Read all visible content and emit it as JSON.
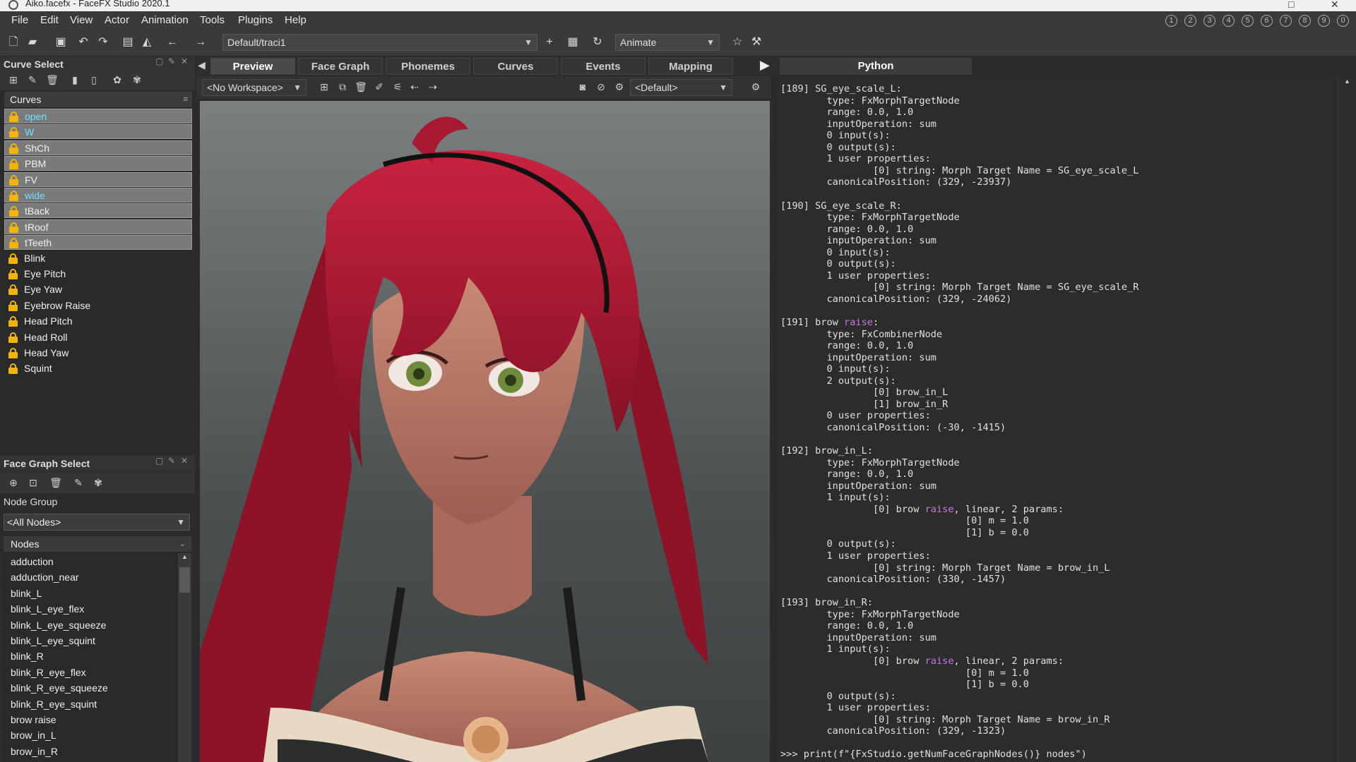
{
  "window": {
    "title": "Aiko.facefx - FaceFX Studio 2020.1"
  },
  "menu": [
    "File",
    "Edit",
    "View",
    "Actor",
    "Animation",
    "Tools",
    "Plugins",
    "Help"
  ],
  "workspace_slots": [
    "1",
    "2",
    "3",
    "4",
    "5",
    "6",
    "7",
    "8",
    "9",
    "0"
  ],
  "toolbar": {
    "path_combo": "Default/traci1",
    "mode_combo": "Animate"
  },
  "curve_select": {
    "title": "Curve Select",
    "list_header": "Curves",
    "items": [
      {
        "label": "open",
        "selected": true,
        "color": "#6fe0ff"
      },
      {
        "label": "W",
        "selected": true,
        "color": "#6fe0ff"
      },
      {
        "label": "ShCh",
        "selected": true
      },
      {
        "label": "PBM",
        "selected": true
      },
      {
        "label": "FV",
        "selected": true
      },
      {
        "label": "wide",
        "selected": true,
        "color": "#6fe0ff"
      },
      {
        "label": "tBack",
        "selected": true
      },
      {
        "label": "tRoof",
        "selected": true
      },
      {
        "label": "tTeeth",
        "selected": true
      },
      {
        "label": "Blink"
      },
      {
        "label": "Eye Pitch"
      },
      {
        "label": "Eye Yaw"
      },
      {
        "label": "Eyebrow Raise"
      },
      {
        "label": "Head Pitch"
      },
      {
        "label": "Head Roll"
      },
      {
        "label": "Head Yaw"
      },
      {
        "label": "Squint"
      }
    ]
  },
  "face_graph_select": {
    "title": "Face Graph Select",
    "node_group_label": "Node Group",
    "node_group_value": "<All Nodes>",
    "nodes_header": "Nodes",
    "nodes": [
      "adduction",
      "adduction_near",
      "blink_L",
      "blink_L_eye_flex",
      "blink_L_eye_squeeze",
      "blink_L_eye_squint",
      "blink_R",
      "blink_R_eye_flex",
      "blink_R_eye_squeeze",
      "blink_R_eye_squint",
      "brow raise",
      "brow_in_L",
      "brow_in_R"
    ]
  },
  "center_tabs": [
    "Preview",
    "Face Graph",
    "Phonemes",
    "Curves",
    "Events",
    "Mapping"
  ],
  "viewport_bar": {
    "workspace": "<No Workspace>",
    "camera": "<Default>"
  },
  "python": {
    "tab": "Python",
    "lines": [
      "[189] SG_eye_scale_L:",
      "        type: FxMorphTargetNode",
      "        range: 0.0, 1.0",
      "        inputOperation: sum",
      "        0 input(s):",
      "        0 output(s):",
      "        1 user properties:",
      "                [0] string: Morph Target Name = SG_eye_scale_L",
      "        canonicalPosition: (329, -23937)",
      "",
      "[190] SG_eye_scale_R:",
      "        type: FxMorphTargetNode",
      "        range: 0.0, 1.0",
      "        inputOperation: sum",
      "        0 input(s):",
      "        0 output(s):",
      "        1 user properties:",
      "                [0] string: Morph Target Name = SG_eye_scale_R",
      "        canonicalPosition: (329, -24062)",
      "",
      "[191] brow raise:",
      "        type: FxCombinerNode",
      "        range: 0.0, 1.0",
      "        inputOperation: sum",
      "        0 input(s):",
      "        2 output(s):",
      "                [0] brow_in_L",
      "                [1] brow_in_R",
      "        0 user properties:",
      "        canonicalPosition: (-30, -1415)",
      "",
      "[192] brow_in_L:",
      "        type: FxMorphTargetNode",
      "        range: 0.0, 1.0",
      "        inputOperation: sum",
      "        1 input(s):",
      "                [0] brow raise, linear, 2 params:",
      "                                [0] m = 1.0",
      "                                [1] b = 0.0",
      "        0 output(s):",
      "        1 user properties:",
      "                [0] string: Morph Target Name = brow_in_L",
      "        canonicalPosition: (330, -1457)",
      "",
      "[193] brow_in_R:",
      "        type: FxMorphTargetNode",
      "        range: 0.0, 1.0",
      "        inputOperation: sum",
      "        1 input(s):",
      "                [0] brow raise, linear, 2 params:",
      "                                [0] m = 1.0",
      "                                [1] b = 0.0",
      "        0 output(s):",
      "        1 user properties:",
      "                [0] string: Morph Target Name = brow_in_R",
      "        canonicalPosition: (329, -1323)",
      "",
      ">>> print(f\"{FxStudio.getNumFaceGraphNodes()} nodes\")"
    ]
  }
}
